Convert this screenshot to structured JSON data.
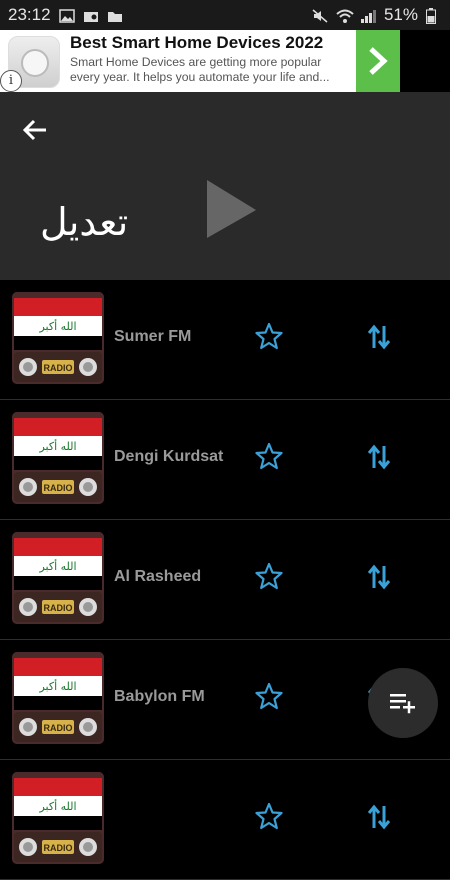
{
  "statusbar": {
    "time": "23:12",
    "battery": "51%"
  },
  "ad": {
    "title": "Best Smart Home Devices 2022",
    "text": "Smart Home Devices are getting more popular every year. It helps you automate your life and...",
    "info": "i"
  },
  "header": {
    "title": "تعديل"
  },
  "stations": [
    {
      "name": "Sumer FM"
    },
    {
      "name": "Dengi Kurdsat"
    },
    {
      "name": "Al Rasheed"
    },
    {
      "name": "Babylon FM"
    },
    {
      "name": ""
    }
  ],
  "thumb": {
    "radio_label": "RADIO"
  },
  "colors": {
    "accent_blue": "#3aa0d8",
    "header_bg": "#2a2a2a",
    "ad_green": "#5cbf4a"
  }
}
